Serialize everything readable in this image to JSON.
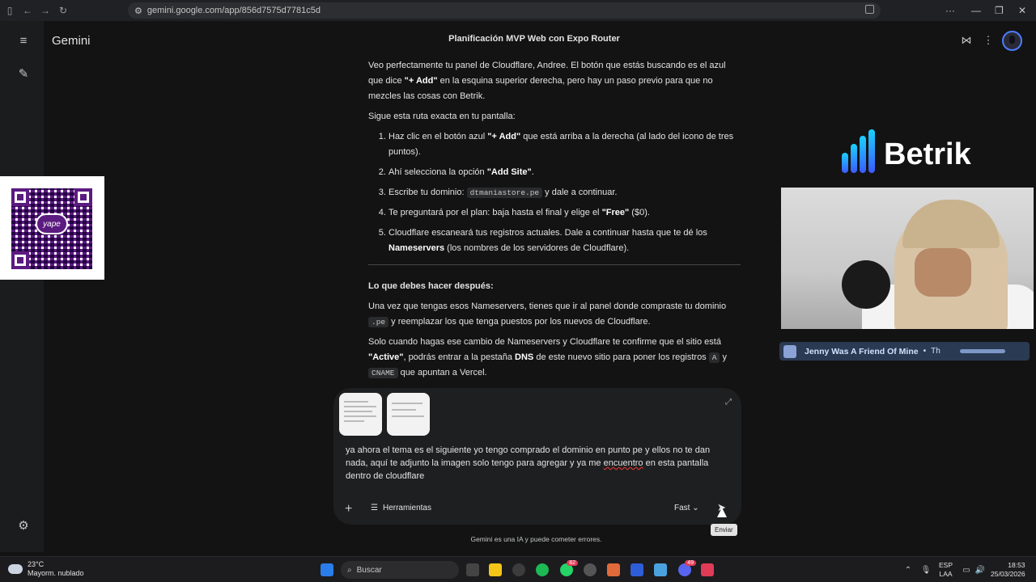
{
  "browser": {
    "url": "gemini.google.com/app/856d7575d7781c5d"
  },
  "app": {
    "name": "Gemini",
    "chat_title": "Planificación MVP Web con Expo Router"
  },
  "response": {
    "intro_1": "Veo perfectamente tu panel de Cloudflare, Andree. El botón que estás buscando es el azul que dice ",
    "intro_bold": "\"+ Add\"",
    "intro_2": " en la esquina superior derecha, pero hay un paso previo para que no mezcles las cosas con Betrik.",
    "route_intro": "Sigue esta ruta exacta en tu pantalla:",
    "steps": [
      {
        "a": "Haz clic en el botón azul ",
        "b": "\"+ Add\"",
        "c": " que está arriba a la derecha (al lado del icono de tres puntos)."
      },
      {
        "a": "Ahí selecciona la opción ",
        "b": "\"Add Site\"",
        "c": "."
      },
      {
        "a": "Escribe tu dominio: ",
        "code": "dtmaniastore.pe",
        "c": " y dale a continuar."
      },
      {
        "a": "Te preguntará por el plan: baja hasta el final y elige el ",
        "b": "\"Free\"",
        "c": " ($0)."
      },
      {
        "a": "Cloudflare escaneará tus registros actuales. Dale a continuar hasta que te dé los ",
        "b": "Nameservers",
        "c": " (los nombres de los servidores de Cloudflare)."
      }
    ],
    "after_heading": "Lo que debes hacer después:",
    "after_1a": "Una vez que tengas esos Nameservers, tienes que ir al panel donde compraste tu dominio ",
    "after_1code": ".pe",
    "after_1b": " y reemplazar los que tenga puestos por los nuevos de Cloudflare.",
    "after_2a": "Solo cuando hagas ese cambio de Nameservers y Cloudflare te confirme que el sitio está ",
    "after_2bold": "\"Active\"",
    "after_2b": ", podrás entrar a la pestaña ",
    "after_2dns": "DNS",
    "after_2c": " de este nuevo sitio para poner los registros ",
    "after_2codeA": "A",
    "after_2d": " y ",
    "after_2codeC": "CNAME",
    "after_2e": " que apuntan a Vercel."
  },
  "composer": {
    "text_1": "ya ahora el tema es el siguiente yo tengo comprado el dominio en punto pe y ellos no te dan nada, aquí te adjunto la imagen solo tengo para agregar y ya me ",
    "text_misspelled": "encuentro",
    "text_2": " en esta pantalla dentro de cloudflare",
    "tools_label": "Herramientas",
    "mode_label": "Fast",
    "send_tooltip": "Enviar"
  },
  "disclaimer": "Gemini es una IA y puede cometer errores.",
  "overlay": {
    "brand": "Betrik",
    "qr_label": "yape",
    "music_title": "Jenny Was A Friend Of Mine",
    "music_sub": "Th"
  },
  "taskbar": {
    "weather_temp": "23°C",
    "weather_desc": "Mayorm. nublado",
    "search_label": "Buscar",
    "badge_whatsapp": "82",
    "badge_discord": "49",
    "lang_1": "ESP",
    "lang_2": "LAA",
    "time": "18:53",
    "date": "25/03/2026"
  },
  "colors": {
    "accent": "#4d7cff",
    "yape_purple": "#5c1b80",
    "music_bar": "#2a3a52"
  }
}
